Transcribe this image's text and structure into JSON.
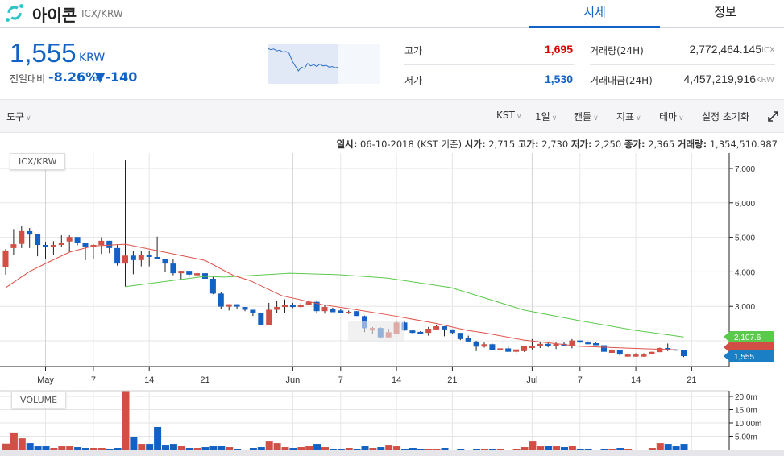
{
  "header": {
    "coin_name": "아이콘",
    "pair": "ICX/KRW",
    "tabs": [
      {
        "label": "시세",
        "active": true
      },
      {
        "label": "정보",
        "active": false
      }
    ]
  },
  "ticker": {
    "price": "1,555",
    "unit": "KRW",
    "change_label": "전일대비",
    "change_pct": "-8.26%",
    "change_abs": "▼-140",
    "color": "#1261c4"
  },
  "sparkline": [
    5.0,
    4.9,
    4.95,
    4.8,
    4.85,
    4.7,
    4.75,
    4.6,
    4.0,
    3.6,
    3.2,
    3.5,
    3.4,
    3.8,
    3.6,
    3.7,
    3.55,
    3.75,
    3.6,
    3.65,
    3.5,
    3.55,
    3.45,
    3.5
  ],
  "stats": {
    "high_label": "고가",
    "high": "1,695",
    "high_color": "#d60000",
    "low_label": "저가",
    "low": "1,530",
    "low_color": "#1261c4",
    "vol_label": "거래량(24H)",
    "vol": "2,772,464.145",
    "vol_unit": "ICX",
    "amt_label": "거래대금(24H)",
    "amt": "4,457,219,916",
    "amt_unit": "KRW"
  },
  "toolbar": {
    "tools": "도구",
    "items": [
      "KST",
      "1일",
      "캔들",
      "지표",
      "테마"
    ],
    "reset": "설정 초기화",
    "fullscreen_icon": "expand-icon"
  },
  "info": {
    "date_label": "일시:",
    "date": "06-10-2018 (KST 기준)",
    "open_label": "시가:",
    "open": "2,715",
    "high_label": "고가:",
    "high": "2,730",
    "low_label": "저가:",
    "low": "2,250",
    "close_label": "종가:",
    "close": "2,365",
    "vol_label": "거래량:",
    "vol": "1,354,510.987"
  },
  "chart_data": [
    {
      "type": "candlestick",
      "title": "ICX/KRW",
      "colors": {
        "up": "#d24f45",
        "down": "#1261c4",
        "ma_short": "#e0524a",
        "ma_long": "#5bc94b"
      },
      "ylim": [
        1000,
        7300
      ],
      "y_ticks": [
        "7,000",
        "6,000",
        "5,000",
        "4,000",
        "3,000"
      ],
      "y_tick_values": [
        7000,
        6000,
        5000,
        4000,
        3000
      ],
      "x_ticks": [
        "May",
        "7",
        "14",
        "21",
        "Jun",
        "7",
        "14",
        "21",
        "Jul",
        "7",
        "14",
        "21"
      ],
      "x_tick_dates": [
        "05-01",
        "05-07",
        "05-14",
        "05-21",
        "06-01",
        "06-07",
        "06-14",
        "06-21",
        "07-01",
        "07-07",
        "07-14",
        "07-21"
      ],
      "grid": true,
      "candles_ohlc": [
        [
          4130,
          4660,
          3920,
          4620
        ],
        [
          4690,
          5240,
          4490,
          4800
        ],
        [
          4810,
          5330,
          4690,
          5180
        ],
        [
          5180,
          5270,
          4690,
          5080
        ],
        [
          5100,
          5100,
          4450,
          4780
        ],
        [
          4780,
          4870,
          4370,
          4720
        ],
        [
          4720,
          4890,
          4500,
          4780
        ],
        [
          4780,
          5060,
          4710,
          4850
        ],
        [
          4880,
          5060,
          4560,
          5010
        ],
        [
          5010,
          5010,
          4770,
          4830
        ],
        [
          4830,
          4830,
          4340,
          4710
        ],
        [
          4710,
          4800,
          4380,
          4780
        ],
        [
          4780,
          5000,
          4520,
          4900
        ],
        [
          4900,
          4900,
          4540,
          4690
        ],
        [
          4690,
          4800,
          4180,
          4240
        ],
        [
          4240,
          7230,
          3570,
          4470
        ],
        [
          4470,
          4600,
          3930,
          4340
        ],
        [
          4340,
          4600,
          4160,
          4500
        ],
        [
          4500,
          4620,
          4160,
          4430
        ],
        [
          4430,
          5020,
          4380,
          4380
        ],
        [
          4380,
          4380,
          4000,
          4240
        ],
        [
          4240,
          4380,
          3900,
          3960
        ],
        [
          3960,
          4030,
          3780,
          4030
        ],
        [
          4030,
          4030,
          3850,
          3920
        ],
        [
          3900,
          4000,
          3850,
          3960
        ],
        [
          3960,
          3960,
          3750,
          3800
        ],
        [
          3800,
          3850,
          3350,
          3370
        ],
        [
          3370,
          3420,
          2920,
          2990
        ],
        [
          2990,
          3060,
          2880,
          3060
        ],
        [
          3060,
          3060,
          2930,
          2990
        ],
        [
          2980,
          2980,
          2860,
          2900
        ],
        [
          2900,
          2900,
          2720,
          2800
        ],
        [
          2800,
          2820,
          2460,
          2460
        ],
        [
          2460,
          3100,
          2460,
          2900
        ],
        [
          2900,
          3150,
          2810,
          2980
        ],
        [
          2980,
          3200,
          2810,
          3050
        ],
        [
          3050,
          3100,
          2950,
          2980
        ],
        [
          2980,
          3100,
          2960,
          3050
        ],
        [
          3050,
          3180,
          3050,
          3130
        ],
        [
          3130,
          3180,
          2790,
          2860
        ],
        [
          2860,
          3030,
          2790,
          2980
        ],
        [
          2930,
          2960,
          2830,
          2830
        ],
        [
          2880,
          2930,
          2800,
          2800
        ],
        [
          2840,
          2880,
          2780,
          2840
        ],
        [
          2860,
          2860,
          2720,
          2720
        ],
        [
          2715,
          2730,
          2250,
          2365
        ],
        [
          2300,
          2400,
          2200,
          2370
        ],
        [
          2370,
          2390,
          2080,
          2100
        ],
        [
          2100,
          2350,
          2070,
          2250
        ],
        [
          2200,
          2560,
          2200,
          2530
        ],
        [
          2530,
          2560,
          2290,
          2300
        ],
        [
          2300,
          2300,
          2220,
          2230
        ],
        [
          2260,
          2280,
          2200,
          2200
        ],
        [
          2230,
          2400,
          2150,
          2350
        ],
        [
          2330,
          2450,
          2330,
          2420
        ],
        [
          2420,
          2420,
          2130,
          2330
        ],
        [
          2330,
          2330,
          2200,
          2230
        ],
        [
          2230,
          2230,
          2020,
          2050
        ],
        [
          2070,
          2150,
          1980,
          1980
        ],
        [
          1980,
          2000,
          1700,
          1830
        ],
        [
          1830,
          1950,
          1800,
          1900
        ],
        [
          1900,
          1920,
          1720,
          1730
        ],
        [
          1730,
          1780,
          1720,
          1780
        ],
        [
          1780,
          1850,
          1680,
          1680
        ],
        [
          1680,
          1750,
          1630,
          1750
        ],
        [
          1700,
          1850,
          1680,
          1850
        ],
        [
          1790,
          2050,
          1750,
          1850
        ],
        [
          1860,
          1960,
          1790,
          1910
        ],
        [
          1910,
          1960,
          1810,
          1860
        ],
        [
          1860,
          1960,
          1760,
          1910
        ],
        [
          1910,
          1960,
          1860,
          1860
        ],
        [
          1860,
          2050,
          1780,
          2010
        ],
        [
          2010,
          2010,
          1950,
          1950
        ],
        [
          1950,
          1980,
          1900,
          1900
        ],
        [
          1930,
          1950,
          1870,
          1870
        ],
        [
          1870,
          1970,
          1680,
          1680
        ],
        [
          1650,
          1780,
          1640,
          1730
        ],
        [
          1730,
          1730,
          1560,
          1600
        ],
        [
          1540,
          1640,
          1540,
          1600
        ],
        [
          1540,
          1640,
          1540,
          1600
        ],
        [
          1540,
          1640,
          1540,
          1600
        ],
        [
          1610,
          1680,
          1610,
          1680
        ],
        [
          1670,
          1800,
          1670,
          1790
        ],
        [
          1790,
          1920,
          1700,
          1720
        ],
        [
          1750,
          1750,
          1720,
          1720
        ],
        [
          1720,
          1720,
          1530,
          1555
        ]
      ],
      "ma_short": [
        [
          0,
          3540
        ],
        [
          3,
          4010
        ],
        [
          5,
          4240
        ],
        [
          8,
          4570
        ],
        [
          11,
          4750
        ],
        [
          15,
          4800
        ],
        [
          19.5,
          4590
        ],
        [
          25,
          4330
        ],
        [
          28.6,
          3890
        ],
        [
          30.6,
          3750
        ],
        [
          34.6,
          3310
        ],
        [
          39.7,
          3050
        ],
        [
          43.7,
          2910
        ],
        [
          48.8,
          2720
        ],
        [
          53.8,
          2510
        ],
        [
          57.9,
          2300
        ],
        [
          60,
          2230
        ],
        [
          65,
          2020
        ],
        [
          72,
          1840
        ],
        [
          80,
          1770
        ],
        [
          84,
          1740
        ]
      ],
      "ma_long": [
        [
          15,
          3570
        ],
        [
          25,
          3870
        ],
        [
          27.5,
          3850
        ],
        [
          35.6,
          3960
        ],
        [
          41.7,
          3920
        ],
        [
          47.8,
          3820
        ],
        [
          55.9,
          3540
        ],
        [
          65,
          2890
        ],
        [
          72,
          2580
        ],
        [
          79,
          2300
        ],
        [
          85,
          2110
        ]
      ],
      "right_labels": [
        {
          "text": "2,107.6",
          "color": "#5bc94b"
        },
        {
          "text": "",
          "color": "#d24f45"
        },
        {
          "text": "1,555",
          "color": "#1a7fc4"
        }
      ]
    },
    {
      "type": "bar",
      "title": "VOLUME",
      "unit": "m",
      "y_ticks": [
        "20.0m",
        "15.0m",
        "10.00m",
        "5.00m"
      ],
      "y_tick_values": [
        20,
        15,
        10,
        5
      ],
      "values": [
        2.2,
        6.4,
        4.2,
        2.4,
        1.2,
        1.2,
        0.6,
        1.2,
        1.2,
        0.9,
        0.6,
        0.6,
        0.6,
        0.3,
        0.6,
        22.1,
        4.8,
        2.1,
        2.1,
        8.5,
        1.8,
        2.1,
        1.2,
        0.6,
        0.6,
        0.9,
        1.2,
        1.5,
        0.9,
        0.3,
        0,
        0.6,
        0.9,
        3.0,
        2.4,
        0.9,
        0.6,
        0.9,
        1.2,
        2.1,
        0.9,
        0.3,
        0.3,
        0.6,
        0.3,
        1.35,
        0.6,
        0.9,
        1.8,
        1.2,
        0.3,
        0.6,
        0.3,
        0.3,
        0.3,
        0.6,
        0,
        0.3,
        0,
        0.3,
        0.3,
        0.3,
        0.3,
        0,
        0.3,
        0.9,
        3.0,
        1.2,
        1.5,
        1.2,
        0.9,
        1.5,
        0.3,
        0.3,
        0,
        0.3,
        0.3,
        0.6,
        0.3,
        0,
        0,
        0.6,
        2.4,
        2.1,
        1.2,
        2.1
      ]
    }
  ]
}
